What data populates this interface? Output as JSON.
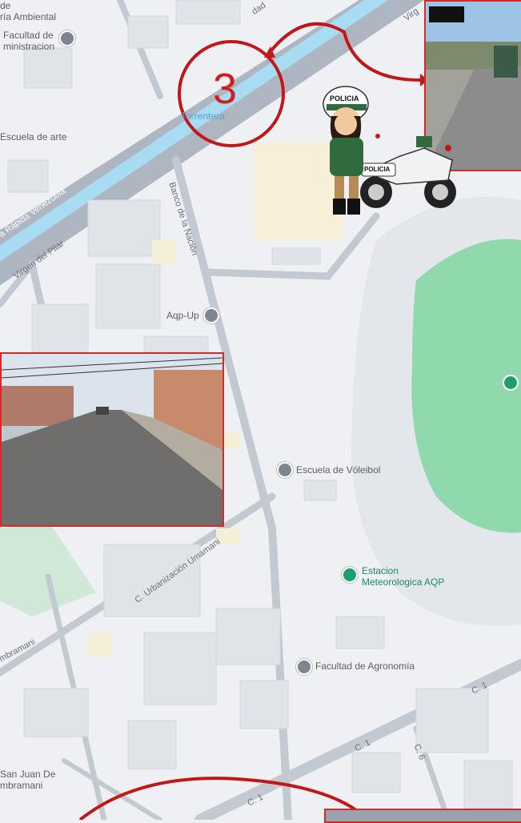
{
  "labels": {
    "ambiental": "de\nría Ambiental",
    "administracion": "Facultad de\nministracion",
    "escuela_arte": "Escuela de arte",
    "torrentera": "Torrentera",
    "aqp_up": "Aqp-Up",
    "voleibol": "Escuela de Vóleibol",
    "estacion": "Estacion\nMeteorologica AQP",
    "agronomia": "Facultad de Agronomía",
    "san_juan": "San Juan De\nmbramani"
  },
  "roads": {
    "via_rapida": "a Rápida Venezuela",
    "virgen_pilar": "Virgen del Pilar",
    "banco_nacion": "Banco de la Nación",
    "urbanizacion": "C. Urbanización Umamani",
    "chambramani": "mbramani",
    "c1_a": "C. 1",
    "c1_b": "C. 1",
    "c1_c": "C. 1",
    "c6": "C. 6",
    "vir_top": "Virg",
    "dad": "dad"
  },
  "annotation": {
    "step_number": "3",
    "police_label": "POLICIA",
    "moto_label": "POLICIA"
  },
  "colors": {
    "annotation_red": "#c01818",
    "park_green": "#8fd9ad",
    "water_blue": "#a8dcf2",
    "poi_green": "#1e9e6a"
  }
}
